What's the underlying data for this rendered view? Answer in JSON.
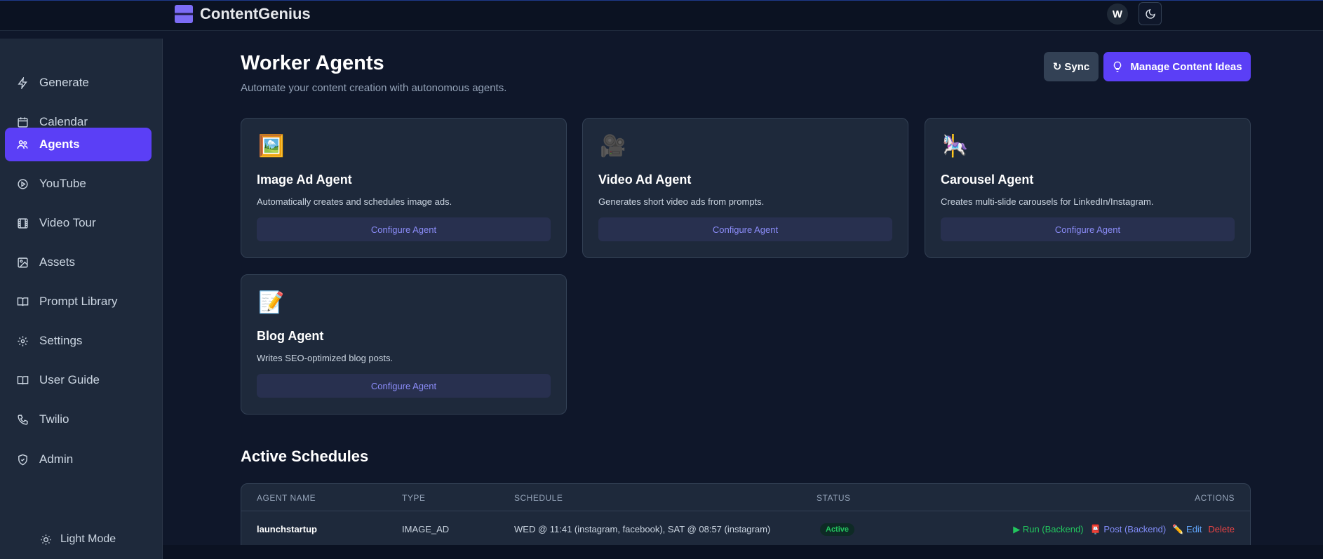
{
  "app": {
    "name": "ContentGenius",
    "avatar_letter": "W",
    "accent_color": "#5b3ff6"
  },
  "sidebar": {
    "items": [
      {
        "label": "Generate",
        "icon": "bolt-icon"
      },
      {
        "label": "Calendar",
        "icon": "calendar-icon"
      },
      {
        "label": "Agents",
        "icon": "users-icon",
        "active": true
      },
      {
        "label": "YouTube",
        "icon": "play-circle-icon"
      },
      {
        "label": "Video Tour",
        "icon": "film-icon"
      },
      {
        "label": "Assets",
        "icon": "image-icon"
      },
      {
        "label": "Prompt Library",
        "icon": "book-icon"
      },
      {
        "label": "Settings",
        "icon": "gear-icon"
      },
      {
        "label": "User Guide",
        "icon": "book-open-icon"
      },
      {
        "label": "Twilio",
        "icon": "phone-icon"
      },
      {
        "label": "Admin",
        "icon": "shield-icon"
      }
    ],
    "light_mode_label": "Light Mode"
  },
  "header": {
    "title": "Worker Agents",
    "subtitle": "Automate your content creation with autonomous agents.",
    "sync_label": "Sync",
    "ideas_label": "Manage Content Ideas"
  },
  "agents": [
    {
      "emoji": "🖼️",
      "name": "Image Ad Agent",
      "desc": "Automatically creates and schedules image ads.",
      "action": "Configure Agent"
    },
    {
      "emoji": "🎥",
      "name": "Video Ad Agent",
      "desc": "Generates short video ads from prompts.",
      "action": "Configure Agent"
    },
    {
      "emoji": "🎠",
      "name": "Carousel Agent",
      "desc": "Creates multi-slide carousels for LinkedIn/Instagram.",
      "action": "Configure Agent"
    },
    {
      "emoji": "📝",
      "name": "Blog Agent",
      "desc": "Writes SEO-optimized blog posts.",
      "action": "Configure Agent"
    }
  ],
  "schedules": {
    "title": "Active Schedules",
    "columns": [
      "AGENT NAME",
      "TYPE",
      "SCHEDULE",
      "STATUS",
      "ACTIONS"
    ],
    "rows": [
      {
        "name": "launchstartup",
        "type": "IMAGE_AD",
        "schedule": "WED @ 11:41 (instagram, facebook), SAT @ 08:57 (instagram)",
        "status": "Active",
        "actions": {
          "run": "▶ Run (Backend)",
          "post": "📮 Post (Backend)",
          "edit": "✏️ Edit",
          "delete": "Delete"
        }
      }
    ]
  }
}
